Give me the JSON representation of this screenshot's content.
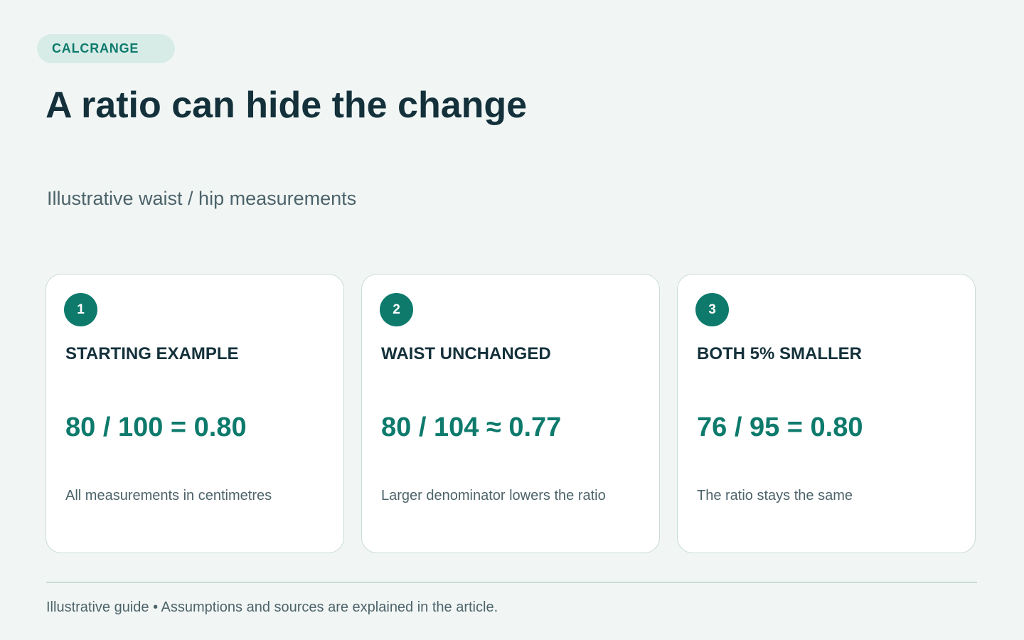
{
  "brand": {
    "label": "CALCRANGE"
  },
  "header": {
    "title": "A ratio can hide the change",
    "subtitle": "Illustrative waist / hip measurements"
  },
  "cards": [
    {
      "step": "1",
      "heading": "STARTING EXAMPLE",
      "formula": "80 / 100 = 0.80",
      "note": "All measurements in centimetres"
    },
    {
      "step": "2",
      "heading": "WAIST UNCHANGED",
      "formula": "80 / 104 ≈ 0.77",
      "note": "Larger denominator lowers the ratio"
    },
    {
      "step": "3",
      "heading": "BOTH 5% SMALLER",
      "formula": "76 / 95 = 0.80",
      "note": "The ratio stays the same"
    }
  ],
  "footer": {
    "text": "Illustrative guide • Assumptions and sources are explained in the article."
  },
  "colors": {
    "background": "#f1f6f5",
    "accent": "#0d7a6c",
    "brand_pill": "#d8ece7",
    "heading": "#14313b",
    "muted_text": "#4d636a",
    "card_border": "#c9dbd7"
  }
}
